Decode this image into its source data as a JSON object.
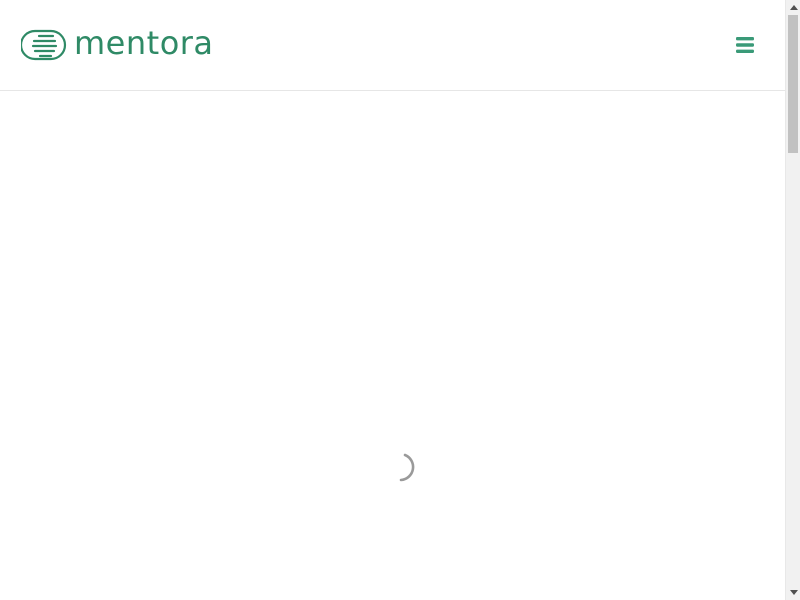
{
  "header": {
    "logo_text": "mentora",
    "logo_icon": "document-stack-icon",
    "menu_icon": "hamburger-menu-icon"
  },
  "content": {
    "loading_icon": "loading-spinner-icon"
  },
  "colors": {
    "brand": "#2f8a66",
    "menu": "#3a9a78",
    "divider": "#e6e6e6",
    "spinner": "#9a9a9a"
  }
}
